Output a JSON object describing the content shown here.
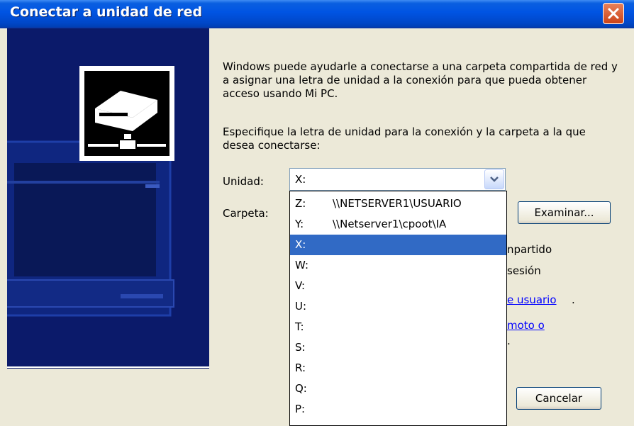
{
  "window": {
    "title": "Conectar a unidad de red"
  },
  "icons": {
    "close": "close-icon",
    "drive": "network-drive-icon",
    "dropdown": "chevron-down-icon"
  },
  "main": {
    "intro": "Windows puede ayudarle a conectarse a una carpeta compartida de red y a asignar una letra de unidad a la conexión para que pueda obtener acceso usando Mi PC.",
    "instruction": "Especifique la letra de unidad para la conexión y la carpeta a la que desea conectarse:",
    "unidad_label": "Unidad:",
    "carpeta_label": "Carpeta:",
    "unidad_value": "X:",
    "examinar_label": "Examinar...",
    "cancelar_label": "Cancelar",
    "partial_texts": [
      "npartido",
      "sesión",
      "e usuario",
      ".",
      "moto o",
      "."
    ]
  },
  "dropdown": {
    "items": [
      {
        "drive": "Z:",
        "path": "\\\\NETSERVER1\\USUARIO"
      },
      {
        "drive": "Y:",
        "path": "\\\\Netserver1\\cpoot\\IA"
      },
      {
        "drive": "X:",
        "path": "",
        "selected": true
      },
      {
        "drive": "W:",
        "path": ""
      },
      {
        "drive": "V:",
        "path": ""
      },
      {
        "drive": "U:",
        "path": ""
      },
      {
        "drive": "T:",
        "path": ""
      },
      {
        "drive": "S:",
        "path": ""
      },
      {
        "drive": "R:",
        "path": ""
      },
      {
        "drive": "Q:",
        "path": ""
      },
      {
        "drive": "P:",
        "path": ""
      }
    ]
  },
  "colors": {
    "title_bar": "#0054e3",
    "side_panel": "#0b1a6a",
    "selection": "#316ac5",
    "link": "#0000ff"
  }
}
